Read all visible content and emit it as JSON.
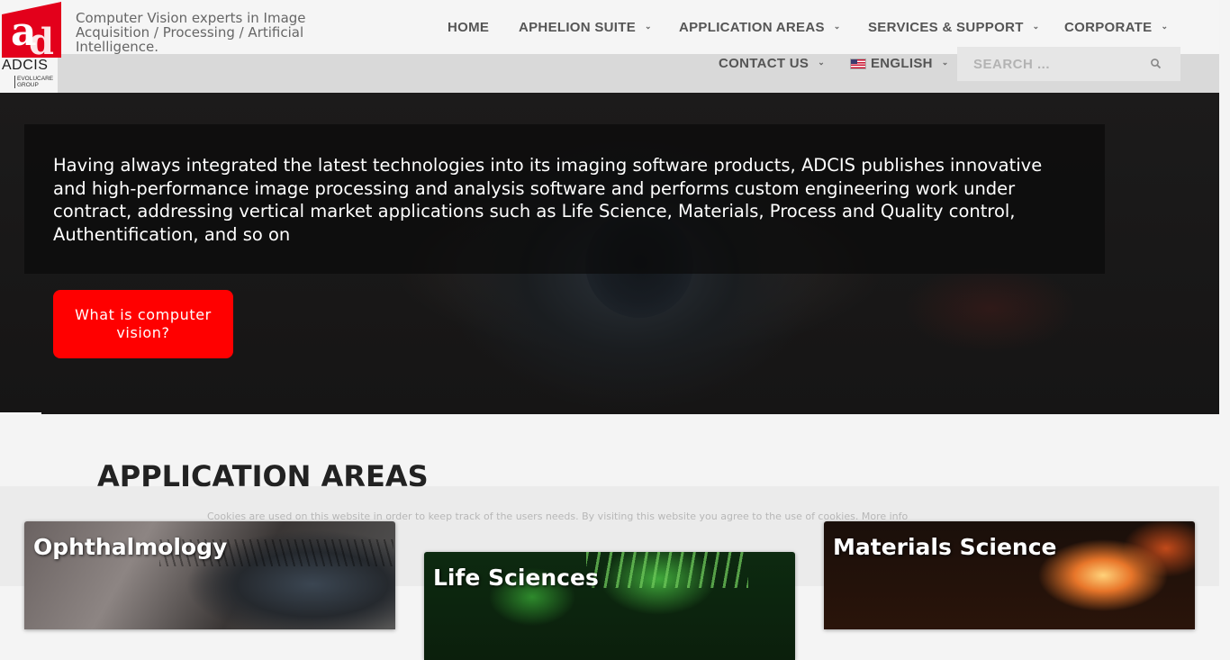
{
  "header": {
    "brand_name": "ADCIS",
    "brand_group": "EVOLUCARE GROUP",
    "tagline": "Computer Vision experts in Image Acquisition / Processing / Artificial Intelligence.",
    "colors": {
      "brand_red": "#e3001b",
      "accent_red": "#ff0000"
    }
  },
  "nav": {
    "items": [
      {
        "label": "HOME",
        "has_dropdown": false
      },
      {
        "label": "APHELION SUITE",
        "has_dropdown": true
      },
      {
        "label": "APPLICATION AREAS",
        "has_dropdown": true
      },
      {
        "label": "SERVICES & SUPPORT",
        "has_dropdown": true
      },
      {
        "label": "CORPORATE",
        "has_dropdown": true
      },
      {
        "label": "CONTACT US",
        "has_dropdown": true
      },
      {
        "label": "ENGLISH",
        "has_dropdown": true,
        "icon": "us-flag-icon"
      }
    ],
    "search_placeholder": "SEARCH ...",
    "search_icon": "search-icon",
    "dropdown_icon": "chevron-down-icon"
  },
  "hero": {
    "caption": "Having always integrated the latest technologies into its imaging software products, ADCIS publishes innovative and high-performance image processing and analysis software and performs custom engineering work under contract, addressing vertical market applications such as Life Science, Materials, Process and Quality control, Authentification, and so on",
    "cta_label": "What is computer vision?"
  },
  "application_areas": {
    "title": "APPLICATION AREAS",
    "cards": [
      {
        "title": "Ophthalmology"
      },
      {
        "title": "Life Sciences"
      },
      {
        "title": "Materials Science"
      }
    ]
  },
  "cookie_notice": {
    "text": "Cookies are used on this website in order to keep track of the users needs. By visiting this website you agree to the use of cookies. More info"
  }
}
